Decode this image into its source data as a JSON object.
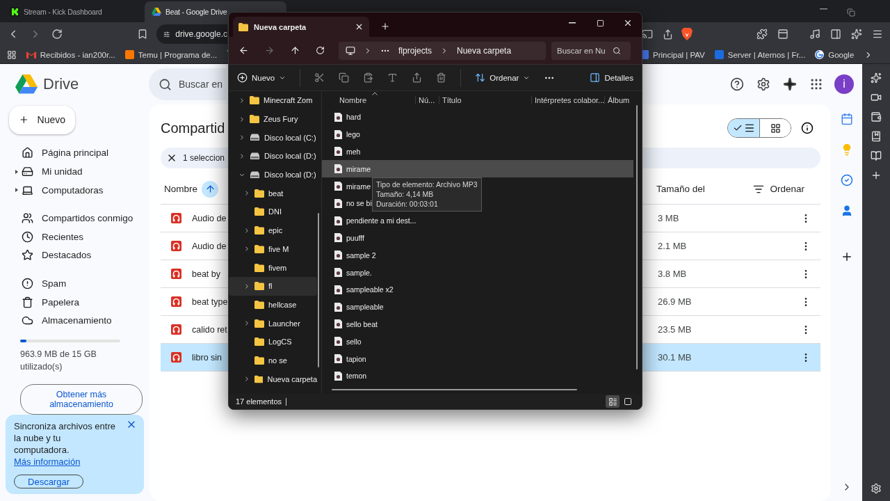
{
  "browser": {
    "tabs": [
      {
        "title": "Stream - Kick Dashboard",
        "selected": false
      },
      {
        "title": "Beat - Google Drive",
        "selected": true
      }
    ],
    "address": "drive.google.c",
    "bookmarks_left": [
      {
        "label": "Recibidos - ian200r..."
      },
      {
        "label": "Temu | Programa de..."
      }
    ],
    "bookmarks_right": [
      {
        "label": "Principal | PAV"
      },
      {
        "label": "Server | Aternos | Fr..."
      },
      {
        "label": "Google"
      }
    ]
  },
  "drive": {
    "product": "Drive",
    "search": {
      "placeholder": "Buscar en"
    },
    "avatar": "i",
    "new_button": "Nuevo",
    "nav_groups": [
      [
        {
          "label": "Página principal",
          "expandable": false
        },
        {
          "label": "Mi unidad",
          "expandable": true
        },
        {
          "label": "Computadoras",
          "expandable": true
        }
      ],
      [
        {
          "label": "Compartidos conmigo",
          "expandable": false
        },
        {
          "label": "Recientes",
          "expandable": false
        },
        {
          "label": "Destacados",
          "expandable": false
        }
      ],
      [
        {
          "label": "Spam",
          "expandable": false
        },
        {
          "label": "Papelera",
          "expandable": false
        },
        {
          "label": "Almacenamiento",
          "expandable": false
        }
      ]
    ],
    "storage": {
      "level": 0.06,
      "text": "963.9 MB de 15 GB utilizado(s)",
      "button": "Obtener más almacenamiento"
    },
    "banner": {
      "text": "Sincroniza archivos entre la nube y tu computadora.",
      "link": "Más información",
      "button": "Descargar"
    },
    "page": {
      "title": "Compartid",
      "views": [
        {
          "kind": "list",
          "selected": true
        },
        {
          "kind": "grid",
          "selected": false
        }
      ],
      "selection": "1 seleccion",
      "columns": {
        "name": "Nombre",
        "size": "Tamaño del",
        "sort": "Ordenar"
      },
      "rows": [
        {
          "name": "Audio de",
          "size": "3 MB",
          "selected": false
        },
        {
          "name": "Audio de",
          "size": "2.1 MB",
          "selected": false
        },
        {
          "name": "beat by",
          "size": "3.8 MB",
          "selected": false
        },
        {
          "name": "beat type",
          "size": "26.9 MB",
          "selected": false
        },
        {
          "name": "calido ret",
          "size": "23.5 MB",
          "selected": false
        },
        {
          "name": "libro sin",
          "size": "30.1 MB",
          "selected": true
        }
      ]
    }
  },
  "explorer": {
    "tab": "Nueva carpeta",
    "breadcrumb": [
      "flprojects",
      "Nueva carpeta"
    ],
    "search": {
      "placeholder": "Buscar en Nu"
    },
    "commands": {
      "new": "Nuevo",
      "sort": "Ordenar",
      "details": "Detalles"
    },
    "tree": [
      {
        "label": "Minecraft Zom",
        "kind": "folder",
        "expandable": true,
        "expanded": false,
        "selected": false
      },
      {
        "label": "Zeus Fury",
        "kind": "folder",
        "expandable": true,
        "expanded": false,
        "selected": false
      },
      {
        "label": "Disco local (C:)",
        "kind": "drive",
        "expandable": true,
        "expanded": false,
        "selected": false
      },
      {
        "label": "Disco local (D:)",
        "kind": "drive",
        "expandable": true,
        "expanded": false,
        "selected": false
      },
      {
        "label": "Disco local (D:)",
        "kind": "drive",
        "expandable": true,
        "expanded": true,
        "selected": false,
        "children": [
          {
            "label": "beat",
            "kind": "folder",
            "expandable": true,
            "expanded": false,
            "selected": false
          },
          {
            "label": "DNI",
            "kind": "folder",
            "expandable": false,
            "expanded": false,
            "selected": false
          },
          {
            "label": "epic",
            "kind": "folder",
            "expandable": true,
            "expanded": false,
            "selected": false
          },
          {
            "label": "five M",
            "kind": "folder",
            "expandable": true,
            "expanded": false,
            "selected": false
          },
          {
            "label": "fivem",
            "kind": "folder",
            "expandable": false,
            "expanded": false,
            "selected": false
          },
          {
            "label": "fl",
            "kind": "folder",
            "expandable": true,
            "expanded": false,
            "selected": true
          },
          {
            "label": "hellcase",
            "kind": "folder",
            "expandable": false,
            "expanded": false,
            "selected": false
          },
          {
            "label": "Launcher",
            "kind": "folder",
            "expandable": true,
            "expanded": false,
            "selected": false
          },
          {
            "label": "LogCS",
            "kind": "folder",
            "expandable": false,
            "expanded": false,
            "selected": false
          },
          {
            "label": "no se",
            "kind": "folder",
            "expandable": false,
            "expanded": false,
            "selected": false
          },
          {
            "label": "Nueva carpeta",
            "kind": "folder",
            "expandable": true,
            "expanded": false,
            "selected": false
          }
        ]
      }
    ],
    "columns": [
      "Nombre",
      "Nú...",
      "Título",
      "Intérpretes colabor...",
      "Álbum"
    ],
    "files": [
      {
        "name": "hard",
        "hovered": false
      },
      {
        "name": "lego",
        "hovered": false
      },
      {
        "name": "meh",
        "hovered": false
      },
      {
        "name": "mirame",
        "hovered": true
      },
      {
        "name": "mirame",
        "hovered": false
      },
      {
        "name": "no se bi",
        "hovered": false
      },
      {
        "name": "pendiente a mi dest...",
        "hovered": false
      },
      {
        "name": "puufff",
        "hovered": false
      },
      {
        "name": "sample 2",
        "hovered": false
      },
      {
        "name": "sample.",
        "hovered": false
      },
      {
        "name": "sampleable x2",
        "hovered": false
      },
      {
        "name": "sampleable",
        "hovered": false
      },
      {
        "name": "sello beat",
        "hovered": false
      },
      {
        "name": "sello",
        "hovered": false
      },
      {
        "name": "tapion",
        "hovered": false
      },
      {
        "name": "temon",
        "hovered": false
      }
    ],
    "tooltip": [
      "Tipo de elemento: Archivo MP3",
      "Tamaño: 4,14 MB",
      "Duración: 00:03:01"
    ],
    "status": "17 elementos",
    "views": [
      {
        "kind": "details",
        "selected": true
      },
      {
        "kind": "tiles",
        "selected": false
      }
    ]
  }
}
